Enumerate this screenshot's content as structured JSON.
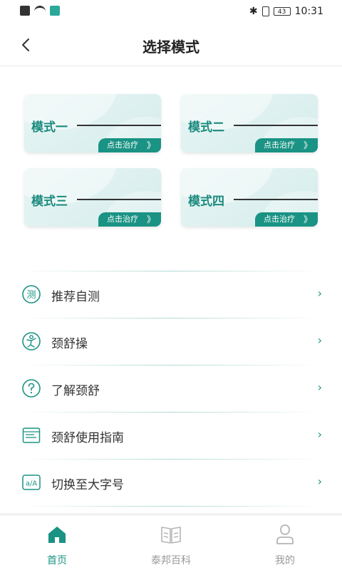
{
  "status_bar": {
    "time": "10:31",
    "battery": "43"
  },
  "header": {
    "title": "选择模式"
  },
  "modes": [
    {
      "name": "模式一",
      "action": "点击治疗"
    },
    {
      "name": "模式二",
      "action": "点击治疗"
    },
    {
      "name": "模式三",
      "action": "点击治疗"
    },
    {
      "name": "模式四",
      "action": "点击治疗"
    }
  ],
  "mode_chevron": "》",
  "menu": [
    {
      "label": "推荐自测",
      "icon": "test-icon"
    },
    {
      "label": "颈舒操",
      "icon": "exercise-icon"
    },
    {
      "label": "了解颈舒",
      "icon": "question-icon"
    },
    {
      "label": "颈舒使用指南",
      "icon": "guide-icon"
    },
    {
      "label": "切换至大字号",
      "icon": "font-size-icon"
    }
  ],
  "menu_arrow": "›",
  "test_icon_char": "测",
  "font_icon_text": "a/A",
  "bottom_nav": [
    {
      "label": "首页",
      "icon": "home-icon",
      "active": true
    },
    {
      "label": "泰邦百科",
      "icon": "book-icon",
      "active": false
    },
    {
      "label": "我的",
      "icon": "user-icon",
      "active": false
    }
  ],
  "colors": {
    "accent": "#1a9384",
    "inactive": "#b5b5b5",
    "card_bg": "#e0f2f1"
  }
}
